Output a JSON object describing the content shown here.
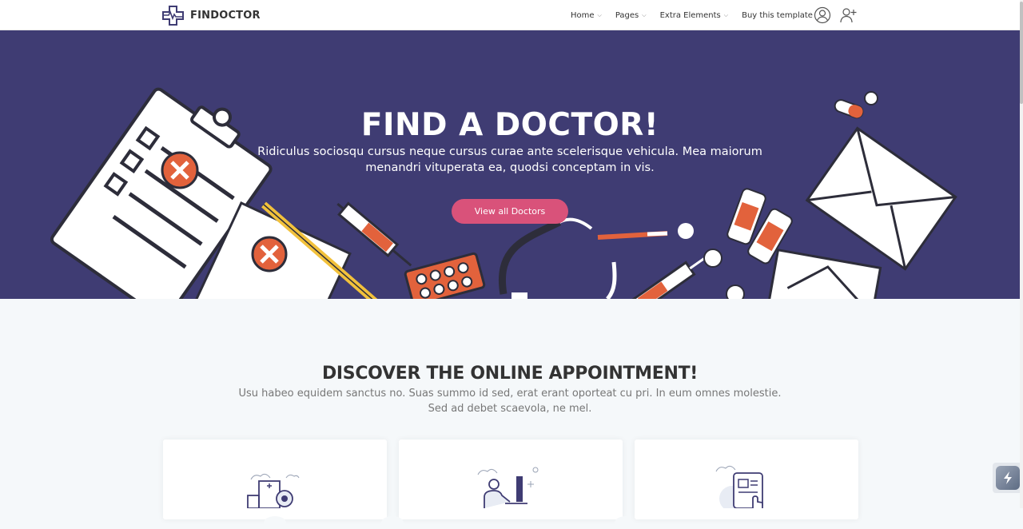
{
  "header": {
    "brand": "FINDOCTOR",
    "nav": [
      {
        "label": "Home"
      },
      {
        "label": "Pages"
      },
      {
        "label": "Extra Elements"
      },
      {
        "label": "Buy this template"
      }
    ],
    "icons": {
      "user": "user-circle-icon",
      "add_user": "add-user-icon"
    }
  },
  "hero": {
    "title": "FIND A DOCTOR!",
    "subtitle": "Ridiculus sociosqu cursus neque cursus curae ante scelerisque vehicula. Mea maiorum menandri vituperata ea, quodsi conceptam in vis.",
    "button": "View all Doctors"
  },
  "discover": {
    "title_pre": "DISCOVER THE ",
    "title_bold": "ONLINE",
    "title_post": " APPOINTMENT!",
    "subtitle": "Usu habeo equidem sanctus no. Suas summo id sed, erat erant oporteat cu pri. In eum omnes molestie. Sed ad debet scaevola, ne mel."
  },
  "cards": [
    {
      "icon": "hospital-search-icon"
    },
    {
      "icon": "doctor-computer-icon"
    },
    {
      "icon": "tablet-touch-icon"
    }
  ],
  "colors": {
    "hero_bg": "#3f3c73",
    "button": "#d9527a",
    "accent_orange": "#e2623c",
    "page_bg": "#f5f8fa"
  }
}
